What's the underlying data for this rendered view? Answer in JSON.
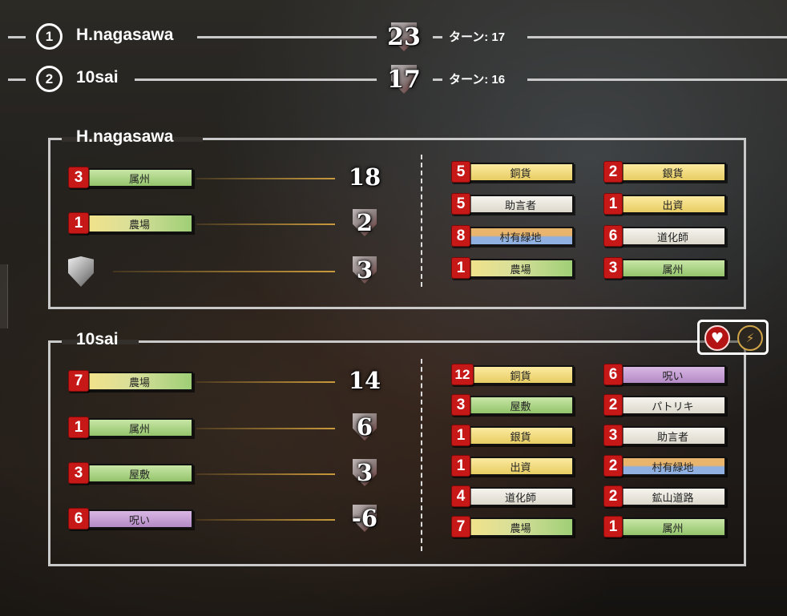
{
  "ranking": [
    {
      "rank": "1",
      "name": "H.nagasawa",
      "score": "23",
      "turn": "ターン: 17"
    },
    {
      "rank": "2",
      "name": "10sai",
      "score": "17",
      "turn": "ターン: 16"
    }
  ],
  "panels": [
    {
      "title": "H.nagasawa",
      "rows": [
        {
          "count": "3",
          "label": "属州",
          "score": "18"
        },
        {
          "count": "1",
          "label": "農場",
          "score": "2"
        },
        {
          "icon": "shield-emblem-icon",
          "score": "3"
        }
      ],
      "cards_left": [
        {
          "count": "5",
          "label": "銅貨"
        },
        {
          "count": "5",
          "label": "助言者"
        },
        {
          "count": "8",
          "label": "村有緑地"
        },
        {
          "count": "1",
          "label": "農場"
        }
      ],
      "cards_right": [
        {
          "count": "2",
          "label": "銀貨"
        },
        {
          "count": "1",
          "label": "出資"
        },
        {
          "count": "6",
          "label": "道化師"
        },
        {
          "count": "3",
          "label": "属州"
        }
      ]
    },
    {
      "title": "10sai",
      "rows": [
        {
          "count": "7",
          "label": "農場",
          "score": "14"
        },
        {
          "count": "1",
          "label": "属州",
          "score": "6"
        },
        {
          "count": "3",
          "label": "屋敷",
          "score": "3"
        },
        {
          "count": "6",
          "label": "呪い",
          "score": "-6"
        }
      ],
      "cards_left": [
        {
          "count": "12",
          "label": "銅貨"
        },
        {
          "count": "3",
          "label": "屋敷"
        },
        {
          "count": "1",
          "label": "銀貨"
        },
        {
          "count": "1",
          "label": "出資"
        },
        {
          "count": "4",
          "label": "道化師"
        },
        {
          "count": "7",
          "label": "農場"
        }
      ],
      "cards_right": [
        {
          "count": "6",
          "label": "呪い"
        },
        {
          "count": "2",
          "label": "パトリキ"
        },
        {
          "count": "3",
          "label": "助言者"
        },
        {
          "count": "2",
          "label": "村有緑地"
        },
        {
          "count": "2",
          "label": "鉱山道路"
        },
        {
          "count": "1",
          "label": "属州"
        }
      ],
      "icons": [
        "heart-icon",
        "lightning-icon"
      ]
    }
  ],
  "colors": {
    "badge": "#c71818",
    "frame": "#c9c9c9",
    "heart": "#b51414",
    "lightning": "#d1a548"
  }
}
